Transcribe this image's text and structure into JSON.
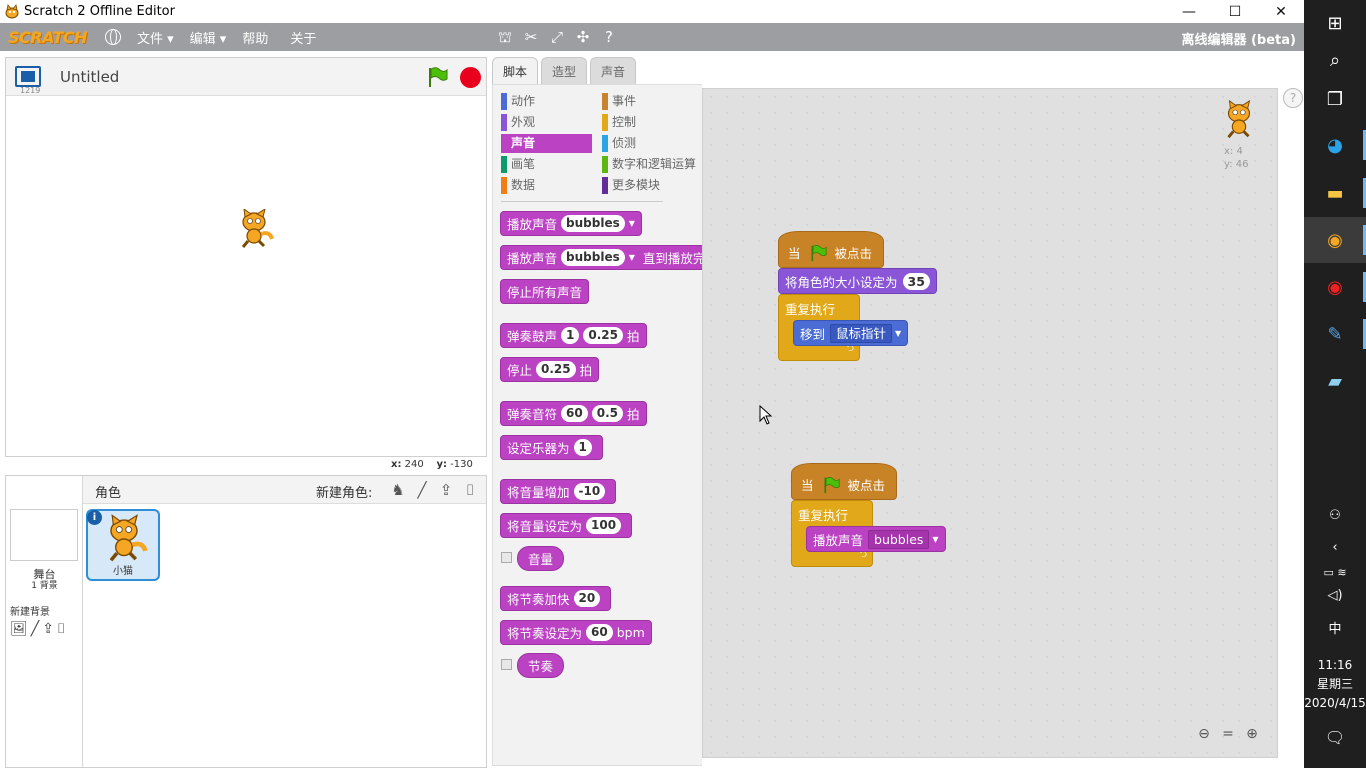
{
  "window": {
    "title": "Scratch 2 Offline Editor",
    "min": "—",
    "max": "☐",
    "close": "✕"
  },
  "menubar": {
    "logo": "SCRATCH",
    "file": "文件 ▾",
    "edit": "编辑 ▾",
    "help": "帮助",
    "about": "关于",
    "mode_label": "离线编辑器 (beta)"
  },
  "stage": {
    "project_title": "Untitled",
    "version": "1219",
    "x_label": "x:",
    "x_value": "240",
    "y_label": "y:",
    "y_value": "-130"
  },
  "sprites": {
    "header": "角色",
    "new_sprite": "新建角色:",
    "stage_label": "舞台",
    "backdrop_count": "1 背景",
    "new_backdrop": "新建背景",
    "sprite_name": "小猫"
  },
  "tabs": [
    "脚本",
    "造型",
    "声音"
  ],
  "categories": {
    "motion": "动作",
    "looks": "外观",
    "sound": "声音",
    "pen": "画笔",
    "data": "数据",
    "events": "事件",
    "control": "控制",
    "sensing": "侦测",
    "operators": "数字和逻辑运算",
    "more": "更多模块"
  },
  "category_colors": {
    "motion": "#4a6cd4",
    "looks": "#8a55d7",
    "sound": "#bb42c3",
    "pen": "#0e9a6c",
    "data": "#ee7d16",
    "events": "#c88330",
    "control": "#e1a91a",
    "sensing": "#2ca5e2",
    "operators": "#5cb712",
    "more": "#632d99"
  },
  "palette": {
    "play_sound": "播放声音",
    "play_sound_sound": "bubbles",
    "play_sound_until": "播放声音",
    "play_sound_until_sound": "bubbles",
    "play_sound_until_suffix": "直到播放完毕",
    "stop_all": "停止所有声音",
    "drum": "弹奏鼓声",
    "drum_n": "1",
    "drum_beats": "0.25",
    "drum_suffix": "拍",
    "rest": "停止",
    "rest_beats": "0.25",
    "rest_suffix": "拍",
    "note": "弹奏音符",
    "note_n": "60",
    "note_beats": "0.5",
    "note_suffix": "拍",
    "instrument": "设定乐器为",
    "instrument_n": "1",
    "change_vol": "将音量增加",
    "change_vol_n": "-10",
    "set_vol": "将音量设定为",
    "set_vol_n": "100",
    "volume": "音量",
    "change_tempo": "将节奏加快",
    "change_tempo_n": "20",
    "set_tempo": "将节奏设定为",
    "set_tempo_n": "60",
    "set_tempo_unit": "bpm",
    "tempo": "节奏"
  },
  "script1": {
    "hat_when": "当",
    "hat_clicked": "被点击",
    "set_size": "将角色的大小设定为",
    "size": "35",
    "forever": "重复执行",
    "goto": "移到",
    "goto_target": "鼠标指针"
  },
  "script2": {
    "hat_when": "当",
    "hat_clicked": "被点击",
    "forever": "重复执行",
    "play_sound": "播放声音",
    "sound": "bubbles"
  },
  "sprite_info": {
    "x": "x: 4",
    "y": "y: 46"
  },
  "help_icon": "?",
  "taskbar": {
    "time": "11:16",
    "weekday": "星期三",
    "date": "2020/4/15",
    "ime": "中"
  }
}
